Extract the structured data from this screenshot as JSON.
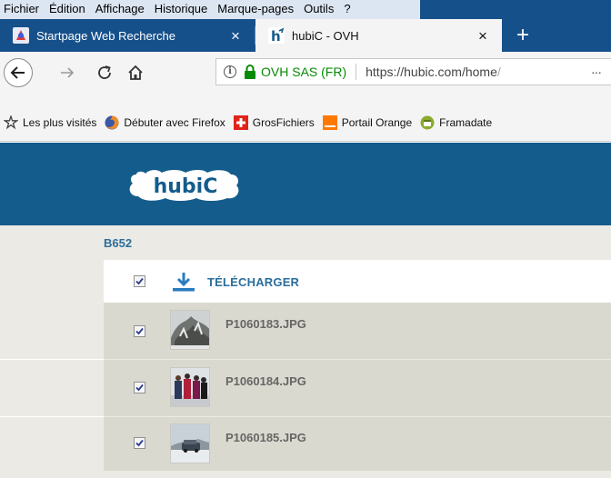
{
  "menu": {
    "items": [
      "Fichier",
      "Édition",
      "Affichage",
      "Historique",
      "Marque-pages",
      "Outils",
      "?"
    ]
  },
  "tabs": [
    {
      "title": "Startpage Web Recherche",
      "active": false,
      "icon": "startpage-icon"
    },
    {
      "title": "hubiC - OVH",
      "active": true,
      "icon": "hubic-h-icon"
    }
  ],
  "tab_close_glyph": "×",
  "new_tab_glyph": "+",
  "nav": {
    "info_glyph": "i",
    "ev_label": "OVH SAS (FR)",
    "url_main": "https://hubic.com/home",
    "url_faded": "/",
    "more_glyph": "···"
  },
  "bookmarks": [
    {
      "label": "Les plus visités",
      "icon": "gear-star-icon"
    },
    {
      "label": "Débuter avec Firefox",
      "icon": "firefox-icon"
    },
    {
      "label": "GrosFichiers",
      "icon": "swiss-cross-icon"
    },
    {
      "label": "Portail Orange",
      "icon": "orange-icon"
    },
    {
      "label": "Framadate",
      "icon": "framadate-icon"
    }
  ],
  "page": {
    "logo_text": "hubiC",
    "breadcrumb": "B652",
    "download_label": "TÉLÉCHARGER",
    "select_all_checked": true,
    "files": [
      {
        "name": "P1060183.JPG",
        "checked": true
      },
      {
        "name": "P1060184.JPG",
        "checked": true
      },
      {
        "name": "P1060185.JPG",
        "checked": true
      }
    ]
  },
  "colors": {
    "header_blue": "#145c8c",
    "link_blue": "#2a6e9c",
    "ev_green": "#058b00",
    "chrome_blue": "#16508a"
  }
}
